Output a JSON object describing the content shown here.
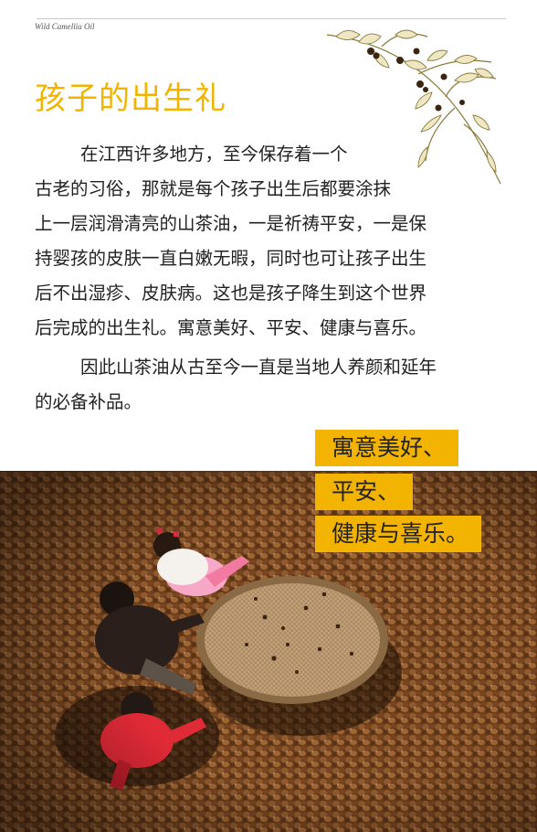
{
  "header": {
    "brand": "Wild Camellia Oil"
  },
  "article": {
    "title": "孩子的出生礼",
    "paragraph1_lines": [
      "在江西许多地方，至今保存着一个",
      "古老的习俗，那就是每个孩子出生后都要涂抹",
      "上一层润滑清亮的山茶油，一是祈祷平安，一是保",
      "持婴孩的皮肤一直白嫩无暇，同时也可让孩子出生",
      "后不出湿疹、皮肤病。这也是孩子降生到这个世界",
      "后完成的出生礼。寓意美好、平安、健康与喜乐。"
    ],
    "paragraph2_lines": [
      "因此山茶油从古至今一直是当地人养颜和延年",
      "的必备补品。"
    ]
  },
  "callouts": [
    "寓意美好、",
    "平安、",
    "健康与喜乐。"
  ],
  "photo": {
    "subject": "children-drying-camellia-seeds",
    "colors": {
      "seeds": "#6b3f1f",
      "shadow": "#2a160b",
      "basket": "#b08a5c",
      "red": "#d8232f",
      "pink": "#f3a7c0"
    }
  },
  "colors": {
    "accent": "#f2b400",
    "text": "#222222"
  }
}
